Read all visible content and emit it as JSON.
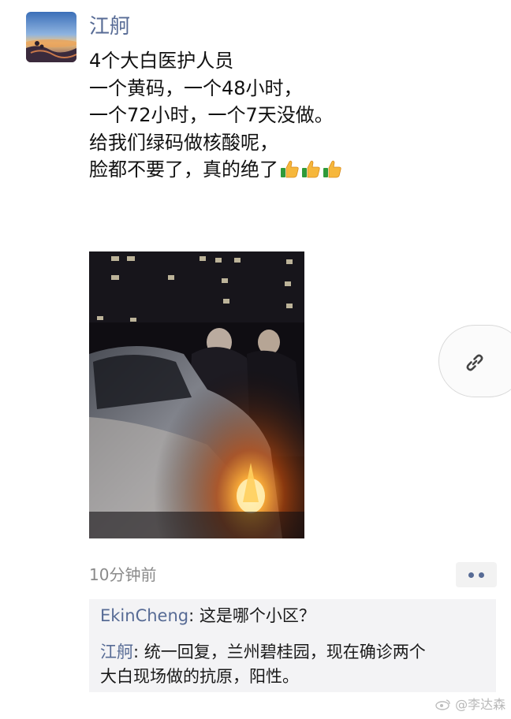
{
  "post": {
    "author": "江舸",
    "lines": [
      "4个大白医护人员",
      "一个黄码，一个48小时，",
      "一个72小时，一个7天没做。",
      "给我们绿码做核酸呢，",
      "脸都不要了，真的绝了"
    ],
    "emoji": [
      "thumbs-up",
      "thumbs-up",
      "thumbs-up"
    ],
    "timestamp": "10分钟前"
  },
  "comments": [
    {
      "author": "EkinCheng",
      "text": ": 这是哪个小区？"
    },
    {
      "author": "江舸",
      "text": ": 统一回复，兰州碧桂园，现在确诊两个",
      "text2": "大白现场做的抗原，阳性。"
    }
  ],
  "watermark": "@李达森",
  "colors": {
    "link_blue": "#576b95",
    "text": "#111111",
    "timestamp_gray": "#8a8a8a",
    "comment_bg": "#f3f3f5"
  },
  "icons": {
    "link": "link-icon",
    "more": "more-dots-icon",
    "thumb": "thumbs-up-emoji"
  }
}
